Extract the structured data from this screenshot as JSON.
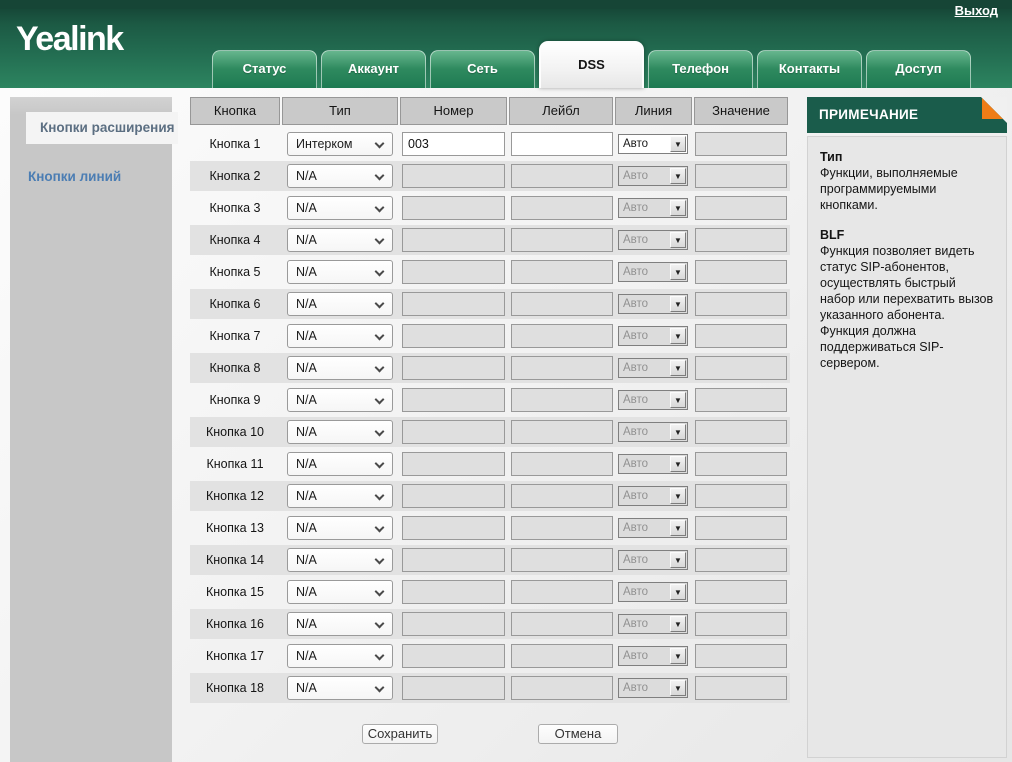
{
  "header": {
    "logo": "Yealink",
    "logout_label": "Выход",
    "tabs": [
      {
        "label": "Статус",
        "active": false
      },
      {
        "label": "Аккаунт",
        "active": false
      },
      {
        "label": "Сеть",
        "active": false
      },
      {
        "label": "DSS",
        "active": true
      },
      {
        "label": "Телефон",
        "active": false
      },
      {
        "label": "Контакты",
        "active": false
      },
      {
        "label": "Доступ",
        "active": false
      }
    ]
  },
  "sidebar": {
    "items": [
      {
        "label": "Кнопки расширения",
        "active": true
      },
      {
        "label": "Кнопки линий",
        "active": false
      }
    ]
  },
  "table": {
    "columns": [
      "Кнопка",
      "Тип",
      "Номер",
      "Лейбл",
      "Линия",
      "Значение"
    ],
    "rows": [
      {
        "label": "Кнопка 1",
        "type": "Интерком",
        "number": "003",
        "label_value": "",
        "line": "Авто",
        "value": "",
        "enabled": true
      },
      {
        "label": "Кнопка 2",
        "type": "N/A",
        "number": "",
        "label_value": "",
        "line": "Авто",
        "value": "",
        "enabled": false
      },
      {
        "label": "Кнопка 3",
        "type": "N/A",
        "number": "",
        "label_value": "",
        "line": "Авто",
        "value": "",
        "enabled": false
      },
      {
        "label": "Кнопка 4",
        "type": "N/A",
        "number": "",
        "label_value": "",
        "line": "Авто",
        "value": "",
        "enabled": false
      },
      {
        "label": "Кнопка 5",
        "type": "N/A",
        "number": "",
        "label_value": "",
        "line": "Авто",
        "value": "",
        "enabled": false
      },
      {
        "label": "Кнопка 6",
        "type": "N/A",
        "number": "",
        "label_value": "",
        "line": "Авто",
        "value": "",
        "enabled": false
      },
      {
        "label": "Кнопка 7",
        "type": "N/A",
        "number": "",
        "label_value": "",
        "line": "Авто",
        "value": "",
        "enabled": false
      },
      {
        "label": "Кнопка 8",
        "type": "N/A",
        "number": "",
        "label_value": "",
        "line": "Авто",
        "value": "",
        "enabled": false
      },
      {
        "label": "Кнопка 9",
        "type": "N/A",
        "number": "",
        "label_value": "",
        "line": "Авто",
        "value": "",
        "enabled": false
      },
      {
        "label": "Кнопка 10",
        "type": "N/A",
        "number": "",
        "label_value": "",
        "line": "Авто",
        "value": "",
        "enabled": false
      },
      {
        "label": "Кнопка 11",
        "type": "N/A",
        "number": "",
        "label_value": "",
        "line": "Авто",
        "value": "",
        "enabled": false
      },
      {
        "label": "Кнопка 12",
        "type": "N/A",
        "number": "",
        "label_value": "",
        "line": "Авто",
        "value": "",
        "enabled": false
      },
      {
        "label": "Кнопка 13",
        "type": "N/A",
        "number": "",
        "label_value": "",
        "line": "Авто",
        "value": "",
        "enabled": false
      },
      {
        "label": "Кнопка 14",
        "type": "N/A",
        "number": "",
        "label_value": "",
        "line": "Авто",
        "value": "",
        "enabled": false
      },
      {
        "label": "Кнопка 15",
        "type": "N/A",
        "number": "",
        "label_value": "",
        "line": "Авто",
        "value": "",
        "enabled": false
      },
      {
        "label": "Кнопка 16",
        "type": "N/A",
        "number": "",
        "label_value": "",
        "line": "Авто",
        "value": "",
        "enabled": false
      },
      {
        "label": "Кнопка 17",
        "type": "N/A",
        "number": "",
        "label_value": "",
        "line": "Авто",
        "value": "",
        "enabled": false
      },
      {
        "label": "Кнопка 18",
        "type": "N/A",
        "number": "",
        "label_value": "",
        "line": "Авто",
        "value": "",
        "enabled": false
      }
    ]
  },
  "actions": {
    "save_label": "Сохранить",
    "cancel_label": "Отмена"
  },
  "note": {
    "title": "ПРИМЕЧАНИЕ",
    "sections": [
      {
        "heading": "Тип",
        "text": "Функции, выполняемые программируемыми кнопками."
      },
      {
        "heading": "BLF",
        "text": "Функция позволяет видеть статус SIP-абонентов, осуществлять быстрый набор или перехватить вызов указанного абонента. Функция должна поддерживаться SIP-сервером."
      }
    ]
  },
  "colors": {
    "header_green": "#1c5a44",
    "note_green": "#1a5c4b",
    "fold_orange": "#ef7d17",
    "link_blue": "#4b7db3",
    "row_stripe": "#e2e2e2"
  }
}
